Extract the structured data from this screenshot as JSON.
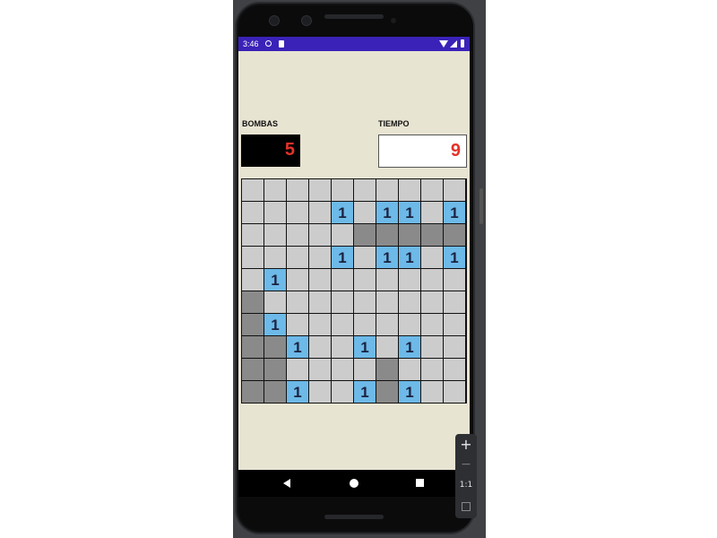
{
  "status_bar": {
    "time": "3:46"
  },
  "game": {
    "bombs_label": "BOMBAS",
    "bombs_value": "5",
    "time_label": "TIEMPO",
    "time_value": "9",
    "board": [
      [
        "H",
        "H",
        "H",
        "H",
        "H",
        "H",
        "H",
        "H",
        "H",
        "H"
      ],
      [
        "H",
        "H",
        "H",
        "H",
        "1",
        "H",
        "1",
        "1",
        "H",
        "1"
      ],
      [
        "H",
        "H",
        "H",
        "H",
        "H",
        "O",
        "O",
        "O",
        "O",
        "O"
      ],
      [
        "H",
        "H",
        "H",
        "H",
        "1",
        "H",
        "1",
        "1",
        "H",
        "1"
      ],
      [
        "H",
        "1",
        "H",
        "H",
        "H",
        "H",
        "H",
        "H",
        "H",
        "H"
      ],
      [
        "O",
        "H",
        "H",
        "H",
        "H",
        "H",
        "H",
        "H",
        "H",
        "H"
      ],
      [
        "O",
        "1",
        "H",
        "H",
        "H",
        "H",
        "H",
        "H",
        "H",
        "H"
      ],
      [
        "O",
        "O",
        "1",
        "H",
        "H",
        "1",
        "H",
        "1",
        "H",
        "H"
      ],
      [
        "O",
        "O",
        "H",
        "H",
        "H",
        "H",
        "O",
        "H",
        "H",
        "H"
      ],
      [
        "O",
        "O",
        "1",
        "H",
        "H",
        "1",
        "O",
        "1",
        "H",
        "H"
      ]
    ]
  },
  "colors": {
    "status_bar": "#3a22b8",
    "screen_bg": "#e8e4d2",
    "counter_text": "#e53228",
    "cell_hidden": "#cccccc",
    "cell_open": "#8a8a8a",
    "cell_number": "#6db9e8"
  },
  "icons": {
    "nav_back": "back-triangle-icon",
    "nav_home": "home-circle-icon",
    "nav_recent": "recent-square-icon"
  },
  "emulator_controls": {
    "zoom_in": "+",
    "zoom_out": "−",
    "ratio": "1:1"
  }
}
